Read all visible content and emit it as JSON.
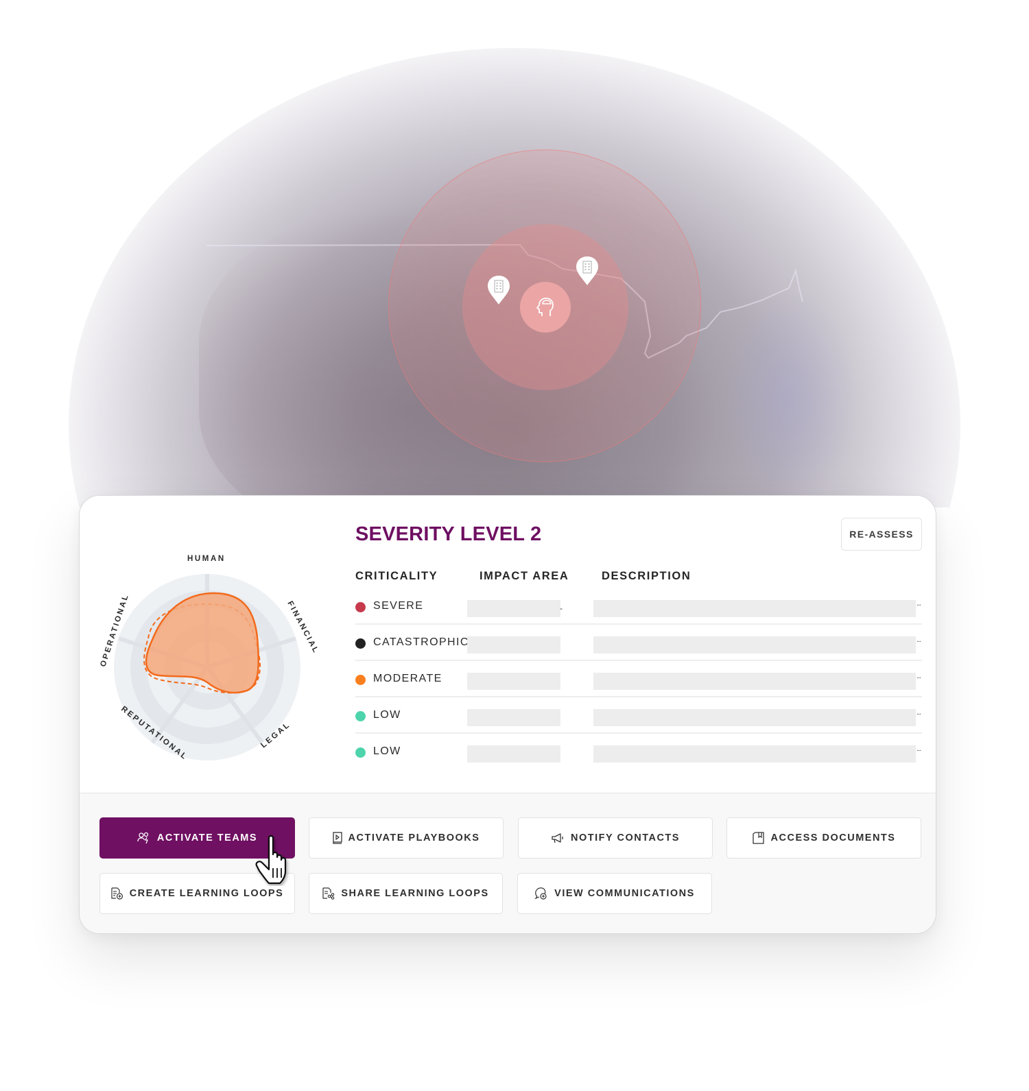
{
  "map": {
    "center_icon": "human-head-brain-icon",
    "pins": [
      {
        "icon": "building-icon"
      },
      {
        "icon": "building-icon"
      }
    ],
    "colors": {
      "radius": "#eba5a5",
      "radius_border": "#f07878"
    }
  },
  "card": {
    "title": "SEVERITY LEVEL 2",
    "title_color": "#6e0f62",
    "reassess_label": "RE-ASSESS",
    "columns": {
      "criticality": "CRITICALITY",
      "impact_area": "IMPACT AREA",
      "description": "DESCRIPTION"
    },
    "rows": [
      {
        "criticality": "SEVERE",
        "color": "#c63a4b",
        "more": "..."
      },
      {
        "criticality": "CATASTROPHIC",
        "color": "#222222",
        "more": "..."
      },
      {
        "criticality": "MODERATE",
        "color": "#f97f1e",
        "more": "..."
      },
      {
        "criticality": "LOW",
        "color": "#4dd4ac",
        "more": "..."
      },
      {
        "criticality": "LOW",
        "color": "#4dd4ac",
        "more": "..."
      }
    ],
    "radar": {
      "axes": [
        "HUMAN",
        "FINANCIAL",
        "LEGAL",
        "REPUTATIONAL",
        "OPERATIONAL"
      ],
      "fill_color": "#f5a77a",
      "stroke_color": "#f36a1c"
    }
  },
  "actions": [
    {
      "label": "ACTIVATE TEAMS",
      "icon": "team-activate-icon",
      "primary": true
    },
    {
      "label": "ACTIVATE PLAYBOOKS",
      "icon": "playbook-icon",
      "primary": false
    },
    {
      "label": "NOTIFY CONTACTS",
      "icon": "megaphone-icon",
      "primary": false
    },
    {
      "label": "ACCESS DOCUMENTS",
      "icon": "document-bookmark-icon",
      "primary": false
    },
    {
      "label": "CREATE LEARNING LOOPS",
      "icon": "document-add-icon",
      "primary": false
    },
    {
      "label": "SHARE LEARNING LOOPS",
      "icon": "document-share-icon",
      "primary": false
    },
    {
      "label": "VIEW COMMUNICATIONS",
      "icon": "chat-add-icon",
      "primary": false
    }
  ],
  "brand_color": "#6f1062"
}
